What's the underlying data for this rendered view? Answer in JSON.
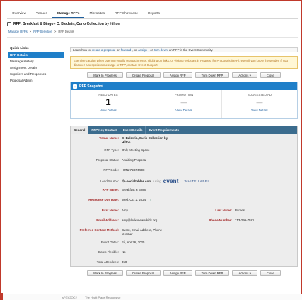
{
  "topnav": {
    "tabs": [
      "Overview",
      "Venues",
      "Manage RFPs",
      "Microsites",
      "RFP Showcase",
      "Reports"
    ],
    "active_index": 2
  },
  "title": "RFP: Breakfast & Bingo - C. Baldwin, Curio Collection by Hilton",
  "breadcrumb": [
    "Manage RFPs",
    "RFP Selection",
    "RFP Details"
  ],
  "sidebar": {
    "heading": "Quick Links",
    "items": [
      "RFP Details",
      "Message History",
      "Assignment Details",
      "Suppliers and Responses",
      "Proposal Admin"
    ],
    "active_index": 0
  },
  "infobar": {
    "prefix": "Learn how to",
    "link1": "create a proposal",
    "or": "or",
    "link2": "forward",
    "comma": ",",
    "link3": "assign",
    "comma2": ", or",
    "link4": "turn down",
    "suffix": "an RFP in the Cvent Community."
  },
  "warning": "Exercise caution when opening emails or attachments, clicking on links, or visiting websites in Request for Proposals (RFP), even if you know the sender. If you discover a suspicious message or RFP, contact Cvent Support.",
  "actions": [
    "Mark In Progress",
    "Create Proposal",
    "Assign RFP",
    "Turn Down RFP",
    "Actions",
    "Close"
  ],
  "snapshot": {
    "title": "RFP Snapshot",
    "columns": [
      {
        "label": "NEED DATES",
        "value": "1",
        "link": "View Details"
      },
      {
        "label": "PROMOTION",
        "value": "—",
        "link": "View Details"
      },
      {
        "label": "SUGGESTED AD",
        "value": "—",
        "link": "View Details"
      }
    ]
  },
  "detail_tabs": [
    "General",
    "RFP Key Contact",
    "Event Details",
    "Event Requirements"
  ],
  "general": {
    "venue_name_label": "Venue Name:",
    "venue_name_line1": "C. Baldwin, Curio Collection by",
    "venue_name_line2": "Hilton",
    "rfp_type_label": "RFP Type:",
    "rfp_type": "Only Meeting Space",
    "proposal_status_label": "Proposal Status:",
    "proposal_status": "Awaiting Proposal",
    "rfp_code_label": "RFP Code:",
    "rfp_code": "HZN276DR5598",
    "lead_source_label": "Lead Source:",
    "lead_source": "ifp-socialtables.com",
    "using": "using",
    "cvent": "cvent",
    "white_label": "WHITE LABEL",
    "rfp_name_label": "RFP Name:",
    "rfp_name": "Breakfast & Bingo",
    "due_date_label": "Response Due Date:",
    "due_date": "Wed, Oct 2, 2024",
    "first_name_label": "First Name:",
    "first_name": "Amy",
    "last_name_label": "Last Name:",
    "last_name": "Barnes",
    "email_label": "Email Address:",
    "email": "amy@lockonewerkids.org",
    "phone_label": "Phone Number:",
    "phone": "713-299-7581",
    "contact_method_label": "Preferred Contact Method:",
    "contact_method_line1": "Cvent, Email Address, Phone",
    "contact_method_line2": "Number",
    "event_dates_label": "Event Dates:",
    "event_dates": "Fri, Apr 26, 2025",
    "dates_flexible_label": "Dates Flexible:",
    "dates_flexible": "No",
    "total_attendees_label": "Total Attendees:",
    "total_attendees": "350"
  },
  "bottom": {
    "frag1": "sFGY2QC2",
    "frag2": "The Hyatt Place Responsive"
  }
}
